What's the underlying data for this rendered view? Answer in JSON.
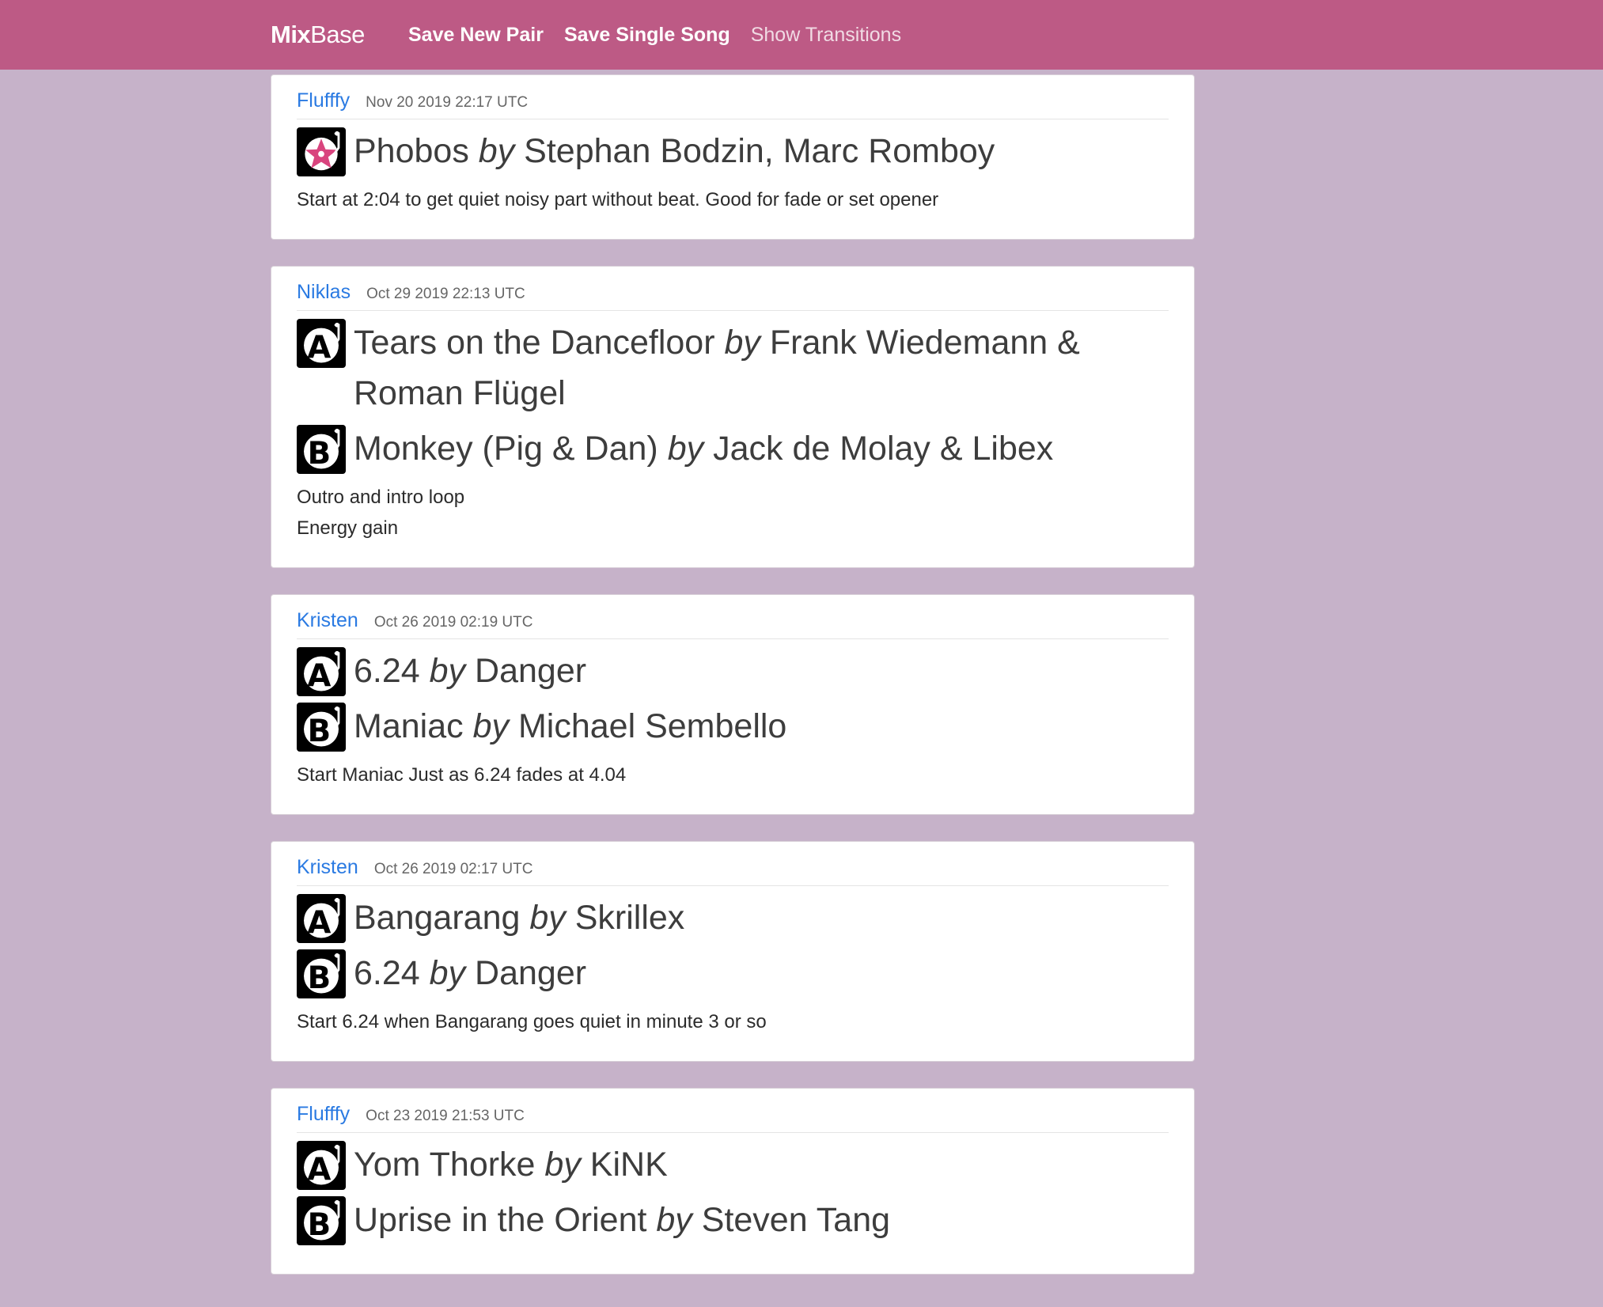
{
  "nav": {
    "brand_bold": "Mix",
    "brand_rest": "Base",
    "links": [
      {
        "label": "Save New Pair"
      },
      {
        "label": "Save Single Song"
      },
      {
        "label": "Show Transitions"
      }
    ]
  },
  "by_word": "by",
  "posts": [
    {
      "user": "Flufffy",
      "time": "Nov 20 2019 22:17 UTC",
      "songs": [
        {
          "slot": "star",
          "title": "Phobos",
          "artist": "Stephan Bodzin, Marc Romboy"
        }
      ],
      "comments": [
        "Start at 2:04 to get quiet noisy part without beat. Good for fade or set opener"
      ]
    },
    {
      "user": "Niklas",
      "time": "Oct 29 2019 22:13 UTC",
      "songs": [
        {
          "slot": "A",
          "title": "Tears on the Dancefloor",
          "artist": "Frank Wiedemann & Roman Flügel"
        },
        {
          "slot": "B",
          "title": "Monkey (Pig & Dan)",
          "artist": "Jack de Molay & Libex"
        }
      ],
      "comments": [
        "Outro and intro loop",
        "Energy gain"
      ]
    },
    {
      "user": "Kristen",
      "time": "Oct 26 2019 02:19 UTC",
      "songs": [
        {
          "slot": "A",
          "title": "6.24",
          "artist": "Danger"
        },
        {
          "slot": "B",
          "title": "Maniac",
          "artist": "Michael Sembello"
        }
      ],
      "comments": [
        "Start Maniac Just as 6.24 fades at 4.04"
      ]
    },
    {
      "user": "Kristen",
      "time": "Oct 26 2019 02:17 UTC",
      "songs": [
        {
          "slot": "A",
          "title": "Bangarang",
          "artist": "Skrillex"
        },
        {
          "slot": "B",
          "title": "6.24",
          "artist": "Danger"
        }
      ],
      "comments": [
        "Start 6.24 when Bangarang goes quiet in minute 3 or so"
      ]
    },
    {
      "user": "Flufffy",
      "time": "Oct 23 2019 21:53 UTC",
      "songs": [
        {
          "slot": "A",
          "title": "Yom Thorke",
          "artist": "KiNK"
        },
        {
          "slot": "B",
          "title": "Uprise in the Orient",
          "artist": "Steven Tang"
        }
      ],
      "comments": []
    }
  ],
  "colors": {
    "navbar": "#bd5a85",
    "background": "#c6b2c9",
    "link": "#2a7ae2",
    "star_accent": "#d9447e"
  },
  "icons": {
    "star": "turntable-star-icon",
    "A": "turntable-a-icon",
    "B": "turntable-b-icon"
  }
}
